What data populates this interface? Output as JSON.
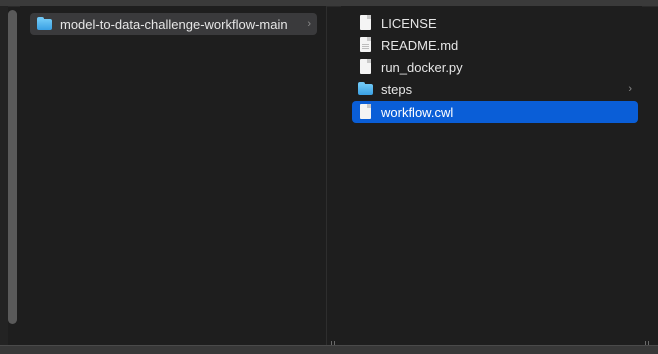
{
  "columns": [
    {
      "items": [
        {
          "label": "model-to-data-challenge-workflow-main",
          "icon": "folder-icon",
          "state": "parent-selected",
          "has_children": true
        }
      ]
    },
    {
      "items": [
        {
          "label": "LICENSE",
          "icon": "file-icon",
          "state": "normal",
          "has_children": false
        },
        {
          "label": "README.md",
          "icon": "file-text-icon",
          "state": "normal",
          "has_children": false
        },
        {
          "label": "run_docker.py",
          "icon": "file-icon",
          "state": "normal",
          "has_children": false
        },
        {
          "label": "steps",
          "icon": "folder-icon",
          "state": "normal",
          "has_children": true
        },
        {
          "label": "workflow.cwl",
          "icon": "file-icon",
          "state": "selected",
          "has_children": false
        }
      ]
    }
  ],
  "chevron_glyph": "›",
  "colors": {
    "background": "#1e1e1e",
    "selection": "#0a5ed7",
    "parent_selection": "#3a3a3c",
    "folder": "#3aa0e4"
  }
}
